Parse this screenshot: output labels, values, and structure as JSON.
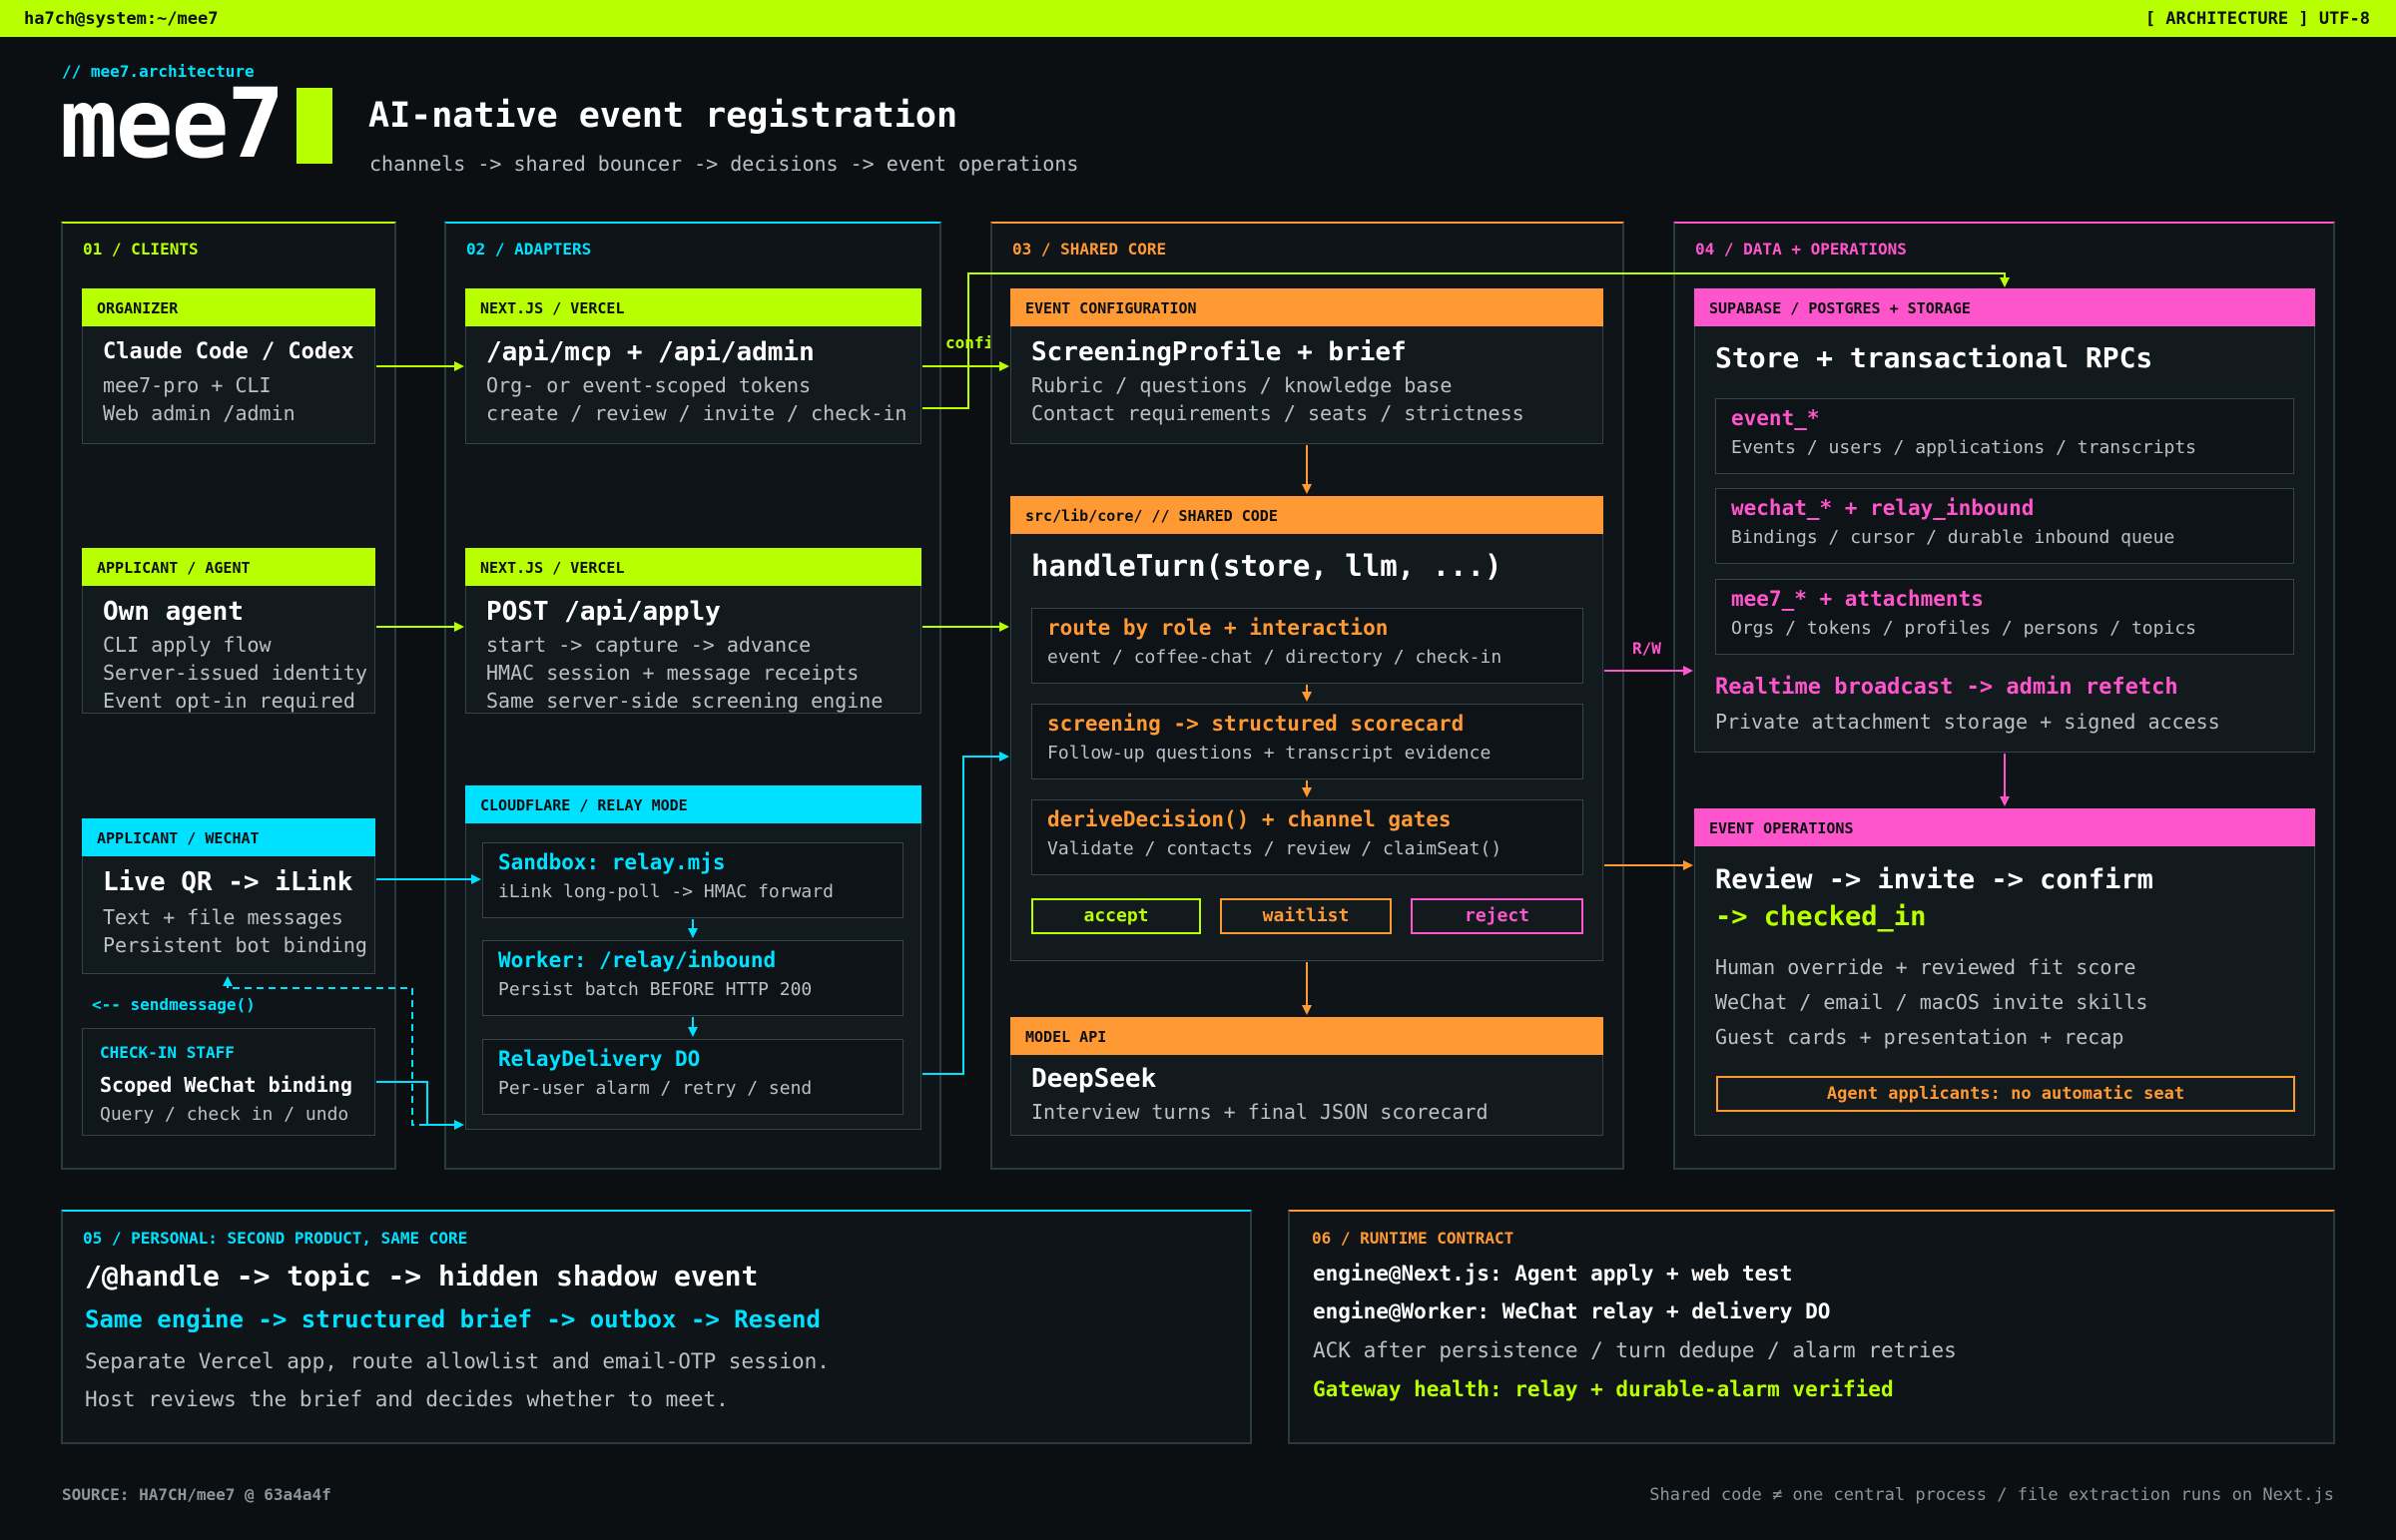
{
  "topbar": {
    "path": "ha7ch@system:~/mee7",
    "tag": "[ ARCHITECTURE ] UTF-8"
  },
  "header": {
    "kicker": "// mee7.architecture",
    "logo": "mee7",
    "title": "AI-native event registration",
    "subtitle": "channels -> shared bouncer -> decisions -> event operations"
  },
  "colors": {
    "lime": "#b8ff00",
    "cyan": "#00e0ff",
    "orange": "#ff9933",
    "pink": "#ff55cc",
    "bg": "#0b0f12"
  },
  "sections": {
    "clients": "01 / CLIENTS",
    "adapters": "02 / ADAPTERS",
    "core": "03 / SHARED CORE",
    "data": "04 / DATA + OPERATIONS",
    "personal": "05 / PERSONAL: SECOND PRODUCT, SAME CORE",
    "runtime": "06 / RUNTIME CONTRACT"
  },
  "clients": {
    "organizer": {
      "head": "ORGANIZER",
      "title": "Claude Code / Codex",
      "lines": [
        "mee7-pro + CLI",
        "Web admin /admin"
      ]
    },
    "agent": {
      "head": "APPLICANT / AGENT",
      "title": "Own agent",
      "lines": [
        "CLI apply flow",
        "Server-issued identity",
        "Event opt-in required"
      ]
    },
    "wechat": {
      "head": "APPLICANT / WECHAT",
      "title": "Live QR -> iLink",
      "lines": [
        "Text + file messages",
        "Persistent bot binding"
      ]
    },
    "sendmessage": "<-- sendmessage()",
    "staff": {
      "head": "CHECK-IN STAFF",
      "title": "Scoped WeChat binding",
      "lines": [
        "Query / check in / undo"
      ]
    }
  },
  "adapters": {
    "mcp": {
      "head": "NEXT.JS / VERCEL",
      "title": "/api/mcp + /api/admin",
      "lines": [
        "Org- or event-scoped tokens",
        "create / review / invite / check-in"
      ]
    },
    "apply": {
      "head": "NEXT.JS / VERCEL",
      "title": "POST /api/apply",
      "lines": [
        "start -> capture -> advance",
        "HMAC session + message receipts",
        "Same server-side screening engine"
      ]
    },
    "relay": {
      "head": "CLOUDFLARE / RELAY MODE",
      "items": [
        {
          "title": "Sandbox: relay.mjs",
          "desc": "iLink long-poll -> HMAC forward"
        },
        {
          "title": "Worker: /relay/inbound",
          "desc": "Persist batch BEFORE HTTP 200"
        },
        {
          "title": "RelayDelivery DO",
          "desc": "Per-user alarm / retry / send"
        }
      ]
    },
    "config_label": "config"
  },
  "core": {
    "config": {
      "head": "EVENT CONFIGURATION",
      "title": "ScreeningProfile + brief",
      "lines": [
        "Rubric / questions / knowledge base",
        "Contact requirements / seats / strictness"
      ]
    },
    "shared": {
      "head": "src/lib/core/ // SHARED CODE",
      "title": "handleTurn(store, llm, ...)",
      "steps": [
        {
          "title": "route by role + interaction",
          "desc": "event / coffee-chat / directory / check-in"
        },
        {
          "title": "screening -> structured scorecard",
          "desc": "Follow-up questions + transcript evidence"
        },
        {
          "title": "deriveDecision() + channel gates",
          "desc": "Validate / contacts / review / claimSeat()"
        }
      ],
      "decisions": [
        "accept",
        "waitlist",
        "reject"
      ]
    },
    "model": {
      "head": "MODEL API",
      "title": "DeepSeek",
      "lines": [
        "Interview turns + final JSON scorecard"
      ]
    },
    "rw_label": "R/W"
  },
  "data": {
    "store": {
      "head": "SUPABASE / POSTGRES + STORAGE",
      "title": "Store + transactional RPCs",
      "tables": [
        {
          "title": "event_*",
          "desc": "Events / users / applications / transcripts"
        },
        {
          "title": "wechat_* + relay_inbound",
          "desc": "Bindings / cursor / durable inbound queue"
        },
        {
          "title": "mee7_* + attachments",
          "desc": "Orgs / tokens / profiles / persons / topics"
        }
      ],
      "realtime": "Realtime broadcast -> admin refetch",
      "storage": "Private attachment storage + signed access"
    },
    "ops": {
      "head": "EVENT OPERATIONS",
      "title1": "Review -> invite -> confirm",
      "title2": "-> checked_in",
      "lines": [
        "Human override + reviewed fit score",
        "WeChat / email / macOS invite skills",
        "Guest cards + presentation + recap"
      ],
      "warning": "Agent applicants: no automatic seat"
    }
  },
  "personal": {
    "title": "/@handle -> topic -> hidden shadow event",
    "accent": "Same engine -> structured brief -> outbox -> Resend",
    "lines": [
      "Separate Vercel app, route allowlist and email-OTP session.",
      "Host reviews the brief and decides whether to meet."
    ]
  },
  "runtime": {
    "lines": [
      "engine@Next.js: Agent apply + web test",
      "engine@Worker: WeChat relay + delivery DO",
      "ACK after persistence / turn dedupe / alarm retries",
      "Gateway health: relay + durable-alarm verified"
    ]
  },
  "footer": {
    "source": "SOURCE: HA7CH/mee7 @ 63a4a4f",
    "note": "Shared code ≠ one central process / file extraction runs on Next.js"
  }
}
